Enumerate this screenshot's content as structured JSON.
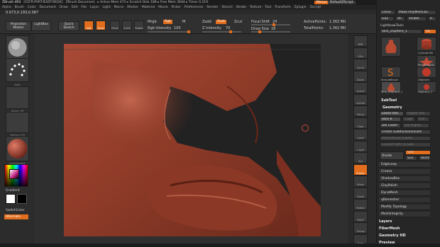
{
  "titlebar": {
    "app": "ZBrush 4R4",
    "items": [
      "[CEFR-PVRT-B3DT-RKQX]",
      "ZBrush Document",
      "▸ Active Mem 473 ▸ Scratch Disk 188 ▸ Free Mem 3644 ▸ Timer 0.219"
    ],
    "menus_btn": "Menus",
    "script_btn": "DefaultZScript"
  },
  "menubar": {
    "items": [
      "Alpha",
      "Brush",
      "Color",
      "Document",
      "Draw",
      "Edit",
      "File",
      "Layer",
      "Light",
      "Macro",
      "Marker",
      "Material",
      "Movie",
      "Picker",
      "Preferences",
      "Render",
      "Stencil",
      "Stroke",
      "Texture",
      "Tool",
      "Transform",
      "Zplugin",
      "Zscript"
    ]
  },
  "coords": "0.673,0.193,0.087",
  "toolbar": {
    "projection_master": "Projection Master",
    "lightbox": "LightBox",
    "quick_sketch": "Quick Sketch",
    "edit": "Edit",
    "draw": "Draw",
    "move": "Move",
    "scale": "Scale",
    "rotate": "Rotate",
    "mrgb": "Mrgb",
    "rgb": "Rgb",
    "m": "M",
    "rgb_intensity_label": "Rgb Intensity",
    "rgb_intensity_value": "100",
    "zadd": "Zadd",
    "zsub": "Zsub",
    "zcut": "Zcut",
    "z_intensity_label": "Z Intensity",
    "z_intensity_value": "70",
    "focal_shift_label": "Focal Shift",
    "focal_shift_value": "24",
    "draw_size_label": "Draw Size",
    "draw_size_value": "18",
    "active_points_label": "ActivePoints:",
    "active_points_value": "1.362 Mil",
    "total_points_label": "TotalPoints:",
    "total_points_value": "1.362 Mil"
  },
  "leftshelf": {
    "brush_label": "Clay",
    "stroke_label": "Dots",
    "alpha_label": "Alpha Off",
    "texture_label": "Texture Off",
    "material_label": "SkinShade4",
    "gradient": "Gradient",
    "switch_color": "SwitchColor",
    "alternate": "Alternate"
  },
  "righttools": [
    "BPR",
    "SPix",
    "Scroll",
    "Zoom",
    "Actual",
    "AAHalf",
    "Persp",
    "Floor",
    "Local",
    "L.Sym",
    "Xyz",
    "Frame",
    "Move",
    "Scale",
    "Rotate",
    "PolyF",
    "Transp",
    "Solo"
  ],
  "panel": {
    "clone": "Clone",
    "make_polymesh": "Make PolyMesh3D",
    "goz": "GoZ",
    "all": "All",
    "visible": "Visible",
    "r": "R",
    "lightbox_tools": "Lightbox▸Tools",
    "tool_name": "Skin_ZSphere_1",
    "tool_count": "48",
    "thumbs": [
      "Skin_ZSphere_1",
      "Cylinder3D",
      "PolyMesh3D",
      "SimpleBrush",
      "ZSphere",
      "Skin_ZSphere_1",
      "ZSphere_1"
    ],
    "subtool": "SubTool",
    "geometry": "Geometry",
    "lower_res": "Lower Res",
    "higher_res": "Higher Res",
    "sdiv": "SDiv 6",
    "cage": "Cage",
    "rstr": "Rstr",
    "del_lower": "Del Lower",
    "del_higher": "Del Higher",
    "freeze_subdiv": "Freeze SubdivisionLevels",
    "reconstruct_subdiv": "Reconstruct Subdiv",
    "convert_bpr": "Convert BPR To Geo",
    "divide": "Divide",
    "smt": "Smt",
    "suv": "Suv",
    "reuv": "ReUV",
    "sections": [
      "EdgeLoop",
      "Crease",
      "ShadowBox",
      "ClayPolish",
      "DynaMesh",
      "qRemesher",
      "Modify Topology",
      "MeshIntegrity"
    ],
    "bottom_sections": [
      "Layers",
      "FiberMesh",
      "Geometry HD",
      "Preview"
    ]
  }
}
